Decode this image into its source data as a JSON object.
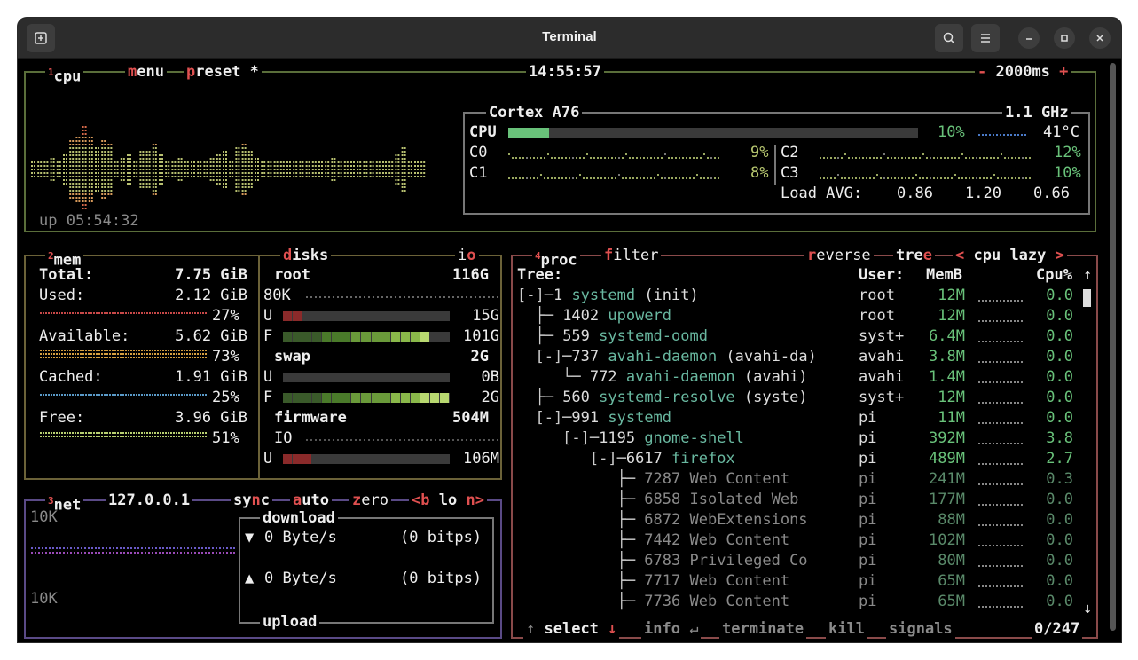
{
  "window": {
    "title": "Terminal"
  },
  "icons": {
    "new_tab": "new-tab-icon",
    "search": "search-icon",
    "menu": "hamburger-menu-icon",
    "minimize": "minimize-icon",
    "maximize": "maximize-icon",
    "close": "close-icon"
  },
  "cpu": {
    "title_num": "1",
    "title": "cpu",
    "menu_m": "m",
    "menu_rest": "enu",
    "preset_p": "p",
    "preset_rest": "reset *",
    "clock": "14:55:57",
    "interval_minus": "-",
    "interval": "2000ms",
    "interval_plus": "+",
    "uptime": "up 05:54:32",
    "model": "Cortex A76",
    "freq": "1.1 GHz",
    "total_label": "CPU",
    "total_pct": "10%",
    "total_fraction": 0.1,
    "temp": "41°C",
    "cores": [
      {
        "name": "C0",
        "pct": "9%"
      },
      {
        "name": "C1",
        "pct": "8%"
      },
      {
        "name": "C2",
        "pct": "12%"
      },
      {
        "name": "C3",
        "pct": "10%"
      }
    ],
    "load_label": "Load AVG:",
    "load": [
      "0.86",
      "1.20",
      "0.66"
    ]
  },
  "mem": {
    "title_num": "2",
    "title": "mem",
    "rows": [
      {
        "label": "Total:",
        "value": "7.75 GiB"
      },
      {
        "label": "Used:",
        "value": "2.12 GiB",
        "pct": "27%",
        "color": "#c84848"
      },
      {
        "label": "Available:",
        "value": "5.62 GiB",
        "pct": "73%",
        "color": "#d8a040"
      },
      {
        "label": "Cached:",
        "value": "1.91 GiB",
        "pct": "25%",
        "color": "#5a9ac8"
      },
      {
        "label": "Free:",
        "value": "3.96 GiB",
        "pct": "51%",
        "color": "#b8d070"
      }
    ]
  },
  "disks": {
    "title_d": "d",
    "title_rest": "isks",
    "io_i": "i",
    "io_o": "o",
    "root_name": "root",
    "root_size": "116G",
    "root_io": "80K",
    "root_used_label": "U",
    "root_used": "15G",
    "root_used_fraction": 0.12,
    "root_free_label": "F",
    "root_free": "101G",
    "root_free_fraction": 0.87,
    "swap_name": "swap",
    "swap_size": "2G",
    "swap_used_label": "U",
    "swap_used": "0B",
    "swap_used_fraction": 0.0,
    "swap_free_label": "F",
    "swap_free": "2G",
    "swap_free_fraction": 1.0,
    "fw_name": "firmware",
    "fw_size": "504M",
    "fw_io": "IO",
    "fw_used_label": "U",
    "fw_used": "106M",
    "fw_used_fraction": 0.18
  },
  "net": {
    "title_num": "3",
    "title": "net",
    "iface": "127.0.0.1",
    "sync_prefix": "sy",
    "sync_n": "n",
    "sync_suffix": "c",
    "auto_a": "a",
    "auto_rest": "uto",
    "zero_z": "z",
    "zero_rest": "ero",
    "prev": "<b",
    "iface_name": "lo",
    "next": "n>",
    "scale_top": "10K",
    "scale_bottom": "10K",
    "download_label": "download",
    "upload_label": "upload",
    "down_arrow": "▼",
    "up_arrow": "▲",
    "down_rate": "0 Byte/s",
    "down_bits": "(0 bitps)",
    "up_rate": "0 Byte/s",
    "up_bits": "(0 bitps)"
  },
  "proc": {
    "title_num": "4",
    "title": "proc",
    "filter_f": "f",
    "filter_rest": "ilter",
    "reverse_r": "r",
    "reverse_rest": "everse",
    "tree_pre": "tre",
    "tree_e": "e",
    "sort_prev": "<",
    "sort": "cpu lazy",
    "sort_next": ">",
    "col_tree": "Tree:",
    "col_user": "User:",
    "col_mem": "MemB",
    "col_cpu": "Cpu%",
    "col_arrow": "↑",
    "rows": [
      {
        "prefix": "[-]─",
        "pid": "1",
        "name": "systemd",
        "args": " (init)",
        "user": "root",
        "mem": "12M",
        "cpu": "0.0",
        "indent": 0,
        "hl": true
      },
      {
        "prefix": "  ├─ ",
        "pid": "1402",
        "name": "upowerd",
        "args": "",
        "user": "root",
        "mem": "12M",
        "cpu": "0.0",
        "indent": 0
      },
      {
        "prefix": "  ├─ ",
        "pid": "559",
        "name": "systemd-oomd",
        "args": "",
        "user": "syst+",
        "mem": "6.4M",
        "cpu": "0.0",
        "indent": 0
      },
      {
        "prefix": "  [-]─",
        "pid": "737",
        "name": "avahi-daemon",
        "args": " (avahi-da)",
        "user": "avahi",
        "mem": "3.8M",
        "cpu": "0.0",
        "indent": 0
      },
      {
        "prefix": "     └─ ",
        "pid": "772",
        "name": "avahi-daemon",
        "args": " (avahi)",
        "user": "avahi",
        "mem": "1.4M",
        "cpu": "0.0",
        "indent": 0
      },
      {
        "prefix": "  ├─ ",
        "pid": "560",
        "name": "systemd-resolve",
        "args": " (syste)",
        "user": "syst+",
        "mem": "12M",
        "cpu": "0.0",
        "indent": 0
      },
      {
        "prefix": "  [-]─",
        "pid": "991",
        "name": "systemd",
        "args": "",
        "user": "pi",
        "mem": "11M",
        "cpu": "0.0",
        "indent": 0
      },
      {
        "prefix": "     [-]─",
        "pid": "1195",
        "name": "gnome-shell",
        "args": "",
        "user": "pi",
        "mem": "392M",
        "cpu": "3.8",
        "indent": 0
      },
      {
        "prefix": "        [-]─",
        "pid": "6617",
        "name": "firefox",
        "args": "",
        "user": "pi",
        "mem": "489M",
        "cpu": "2.7",
        "indent": 0
      },
      {
        "prefix": "           ├─ ",
        "pid": "7287",
        "name": "Web Content",
        "args": "",
        "user": "pi",
        "mem": "241M",
        "cpu": "0.3",
        "indent": 0
      },
      {
        "prefix": "           ├─ ",
        "pid": "6858",
        "name": "Isolated Web",
        "args": "",
        "user": "pi",
        "mem": "177M",
        "cpu": "0.0",
        "indent": 0
      },
      {
        "prefix": "           ├─ ",
        "pid": "6872",
        "name": "WebExtensions",
        "args": "",
        "user": "pi",
        "mem": "88M",
        "cpu": "0.0",
        "indent": 0
      },
      {
        "prefix": "           ├─ ",
        "pid": "7442",
        "name": "Web Content",
        "args": "",
        "user": "pi",
        "mem": "102M",
        "cpu": "0.0",
        "indent": 0
      },
      {
        "prefix": "           ├─ ",
        "pid": "6783",
        "name": "Privileged Co",
        "args": "",
        "user": "pi",
        "mem": "80M",
        "cpu": "0.0",
        "indent": 0
      },
      {
        "prefix": "           ├─ ",
        "pid": "7717",
        "name": "Web Content",
        "args": "",
        "user": "pi",
        "mem": "65M",
        "cpu": "0.0",
        "indent": 0
      },
      {
        "prefix": "           ├─ ",
        "pid": "7736",
        "name": "Web Content",
        "args": "",
        "user": "pi",
        "mem": "65M",
        "cpu": "0.0",
        "indent": 0
      }
    ],
    "bottom_up": "↑",
    "select": "select",
    "bottom_down": "↓",
    "info_i": "i",
    "info_rest": "nfo",
    "enter": "↵",
    "terminate_t": "t",
    "terminate_rest": "erminate",
    "kill_k": "k",
    "kill_rest": "ill",
    "signals_s": "s",
    "signals_rest": "ignals",
    "count": "0/247",
    "scroll_down": "↓"
  }
}
